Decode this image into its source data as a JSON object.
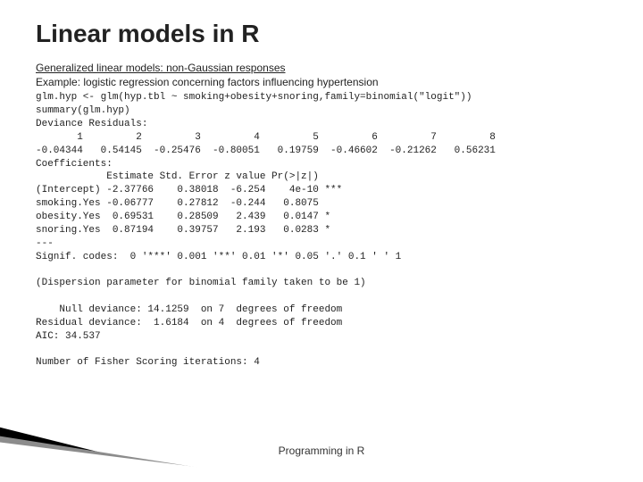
{
  "title": "Linear models in R",
  "subhead": "Generalized linear models: non-Gaussian responses",
  "desc": "Example: logistic regression concerning factors influencing hypertension",
  "code": "glm.hyp <- glm(hyp.tbl ~ smoking+obesity+snoring,family=binomial(\"logit\"))\nsummary(glm.hyp)\nDeviance Residuals:\n       1         2         3         4         5         6         7         8\n-0.04344   0.54145  -0.25476  -0.80051   0.19759  -0.46602  -0.21262   0.56231\nCoefficients:\n            Estimate Std. Error z value Pr(>|z|)\n(Intercept) -2.37766    0.38018  -6.254    4e-10 ***\nsmoking.Yes -0.06777    0.27812  -0.244   0.8075\nobesity.Yes  0.69531    0.28509   2.439   0.0147 *\nsnoring.Yes  0.87194    0.39757   2.193   0.0283 *\n---\nSignif. codes:  0 '***' 0.001 '**' 0.01 '*' 0.05 '.' 0.1 ' ' 1\n\n(Dispersion parameter for binomial family taken to be 1)\n\n    Null deviance: 14.1259  on 7  degrees of freedom\nResidual deviance:  1.6184  on 4  degrees of freedom\nAIC: 34.537\n\nNumber of Fisher Scoring iterations: 4",
  "footer": "Programming in R"
}
